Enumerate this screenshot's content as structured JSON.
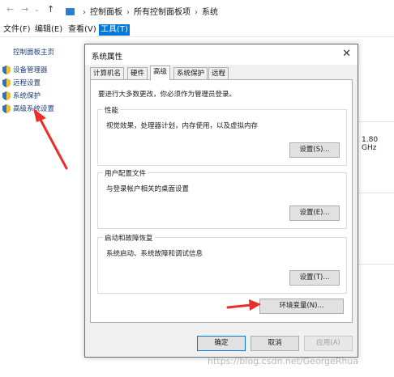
{
  "breadcrumb": [
    "控制面板",
    "所有控制面板项",
    "系统"
  ],
  "menubar": [
    "文件(F)",
    "编辑(E)",
    "查看(V)",
    "工具(T)"
  ],
  "left_pane": {
    "title": "控制面板主页",
    "links": [
      "设备管理器",
      "远程设置",
      "系统保护",
      "高级系统设置"
    ]
  },
  "background_info": {
    "cpu_speed": "1.80 GHz"
  },
  "dialog": {
    "title": "系统属性",
    "tabs": [
      "计算机名",
      "硬件",
      "高级",
      "系统保护",
      "远程"
    ],
    "active_tab": "高级",
    "intro": "要进行大多数更改，你必须作为管理员登录。",
    "groups": [
      {
        "label": "性能",
        "desc": "视觉效果，处理器计划，内存使用，以及虚拟内存",
        "button": "设置(S)..."
      },
      {
        "label": "用户配置文件",
        "desc": "与登录帐户相关的桌面设置",
        "button": "设置(E)..."
      },
      {
        "label": "启动和故障恢复",
        "desc": "系统启动、系统故障和调试信息",
        "button": "设置(T)..."
      }
    ],
    "env_button": "环境变量(N)...",
    "ok": "确定",
    "cancel": "取消",
    "apply": "应用(A)"
  },
  "watermark": "https://blog.csdn.net/GeorgeRhua",
  "colors": {
    "accent": "#0078d7",
    "link": "#1f3d7a",
    "arrow": "#e8302a"
  }
}
